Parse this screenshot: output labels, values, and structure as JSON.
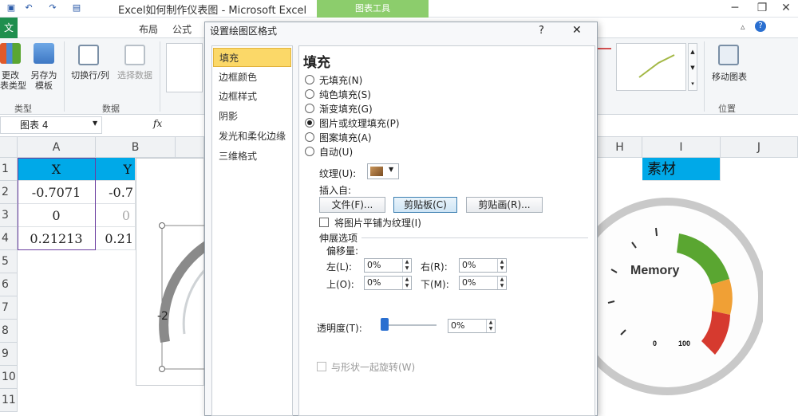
{
  "window": {
    "title": "Excel如何制作仪表图 - Microsoft Excel",
    "chart_tools": "图表工具"
  },
  "menus": {
    "file": "文件",
    "layout": "布局",
    "formulas": "公式"
  },
  "ribbon": {
    "change_type": "更改\n表类型",
    "save_template": "另存为\n模板",
    "switch_row_col": "切换行/列",
    "select_data": "选择数据",
    "group_type": "类型",
    "group_data": "数据",
    "move_chart": "移动图表",
    "group_location": "位置"
  },
  "formula_bar": {
    "name_box": "图表 4",
    "fx": "fx"
  },
  "sheet": {
    "columns": [
      "A",
      "B",
      "H",
      "I",
      "J"
    ],
    "rows": [
      "1",
      "2",
      "3",
      "4",
      "5",
      "6",
      "7",
      "8",
      "9",
      "10",
      "11"
    ],
    "a1": "X",
    "b1": "Y",
    "a2": "-0.7071",
    "b2": "-0.7",
    "a3": "0",
    "b3": "0",
    "a4": "0.21213",
    "b4": "0.21",
    "i1": "素材"
  },
  "chart_left": {
    "axis_label": "-2"
  },
  "gauge": {
    "title": "Memory",
    "min_label": "0",
    "max_label": "100",
    "colors": {
      "green": "#5aa631",
      "orange": "#f0a035",
      "red": "#d63a2f"
    }
  },
  "dialog": {
    "title": "设置绘图区格式",
    "help": "?",
    "close": "✕",
    "nav": [
      "填充",
      "边框颜色",
      "边框样式",
      "阴影",
      "发光和柔化边缘",
      "三维格式"
    ],
    "heading": "填充",
    "fill_options": [
      "无填充(N)",
      "纯色填充(S)",
      "渐变填充(G)",
      "图片或纹理填充(P)",
      "图案填充(A)",
      "自动(U)"
    ],
    "selected_fill": "图片或纹理填充(P)",
    "texture_label": "纹理(U):",
    "insert_from": "插入自:",
    "btn_file": "文件(F)...",
    "btn_clipboard": "剪贴板(C)",
    "btn_clipart": "剪贴画(R)...",
    "tile_label": "将图片平铺为纹理(I)",
    "stretch_options": "伸展选项",
    "offsets": "偏移量:",
    "left": "左(L):",
    "right": "右(R):",
    "top": "上(O):",
    "bottom": "下(M):",
    "left_val": "0%",
    "right_val": "0%",
    "top_val": "0%",
    "bottom_val": "0%",
    "transparency": "透明度(T):",
    "transparency_val": "0%",
    "rotate_label": "与形状一起旋转(W)"
  }
}
